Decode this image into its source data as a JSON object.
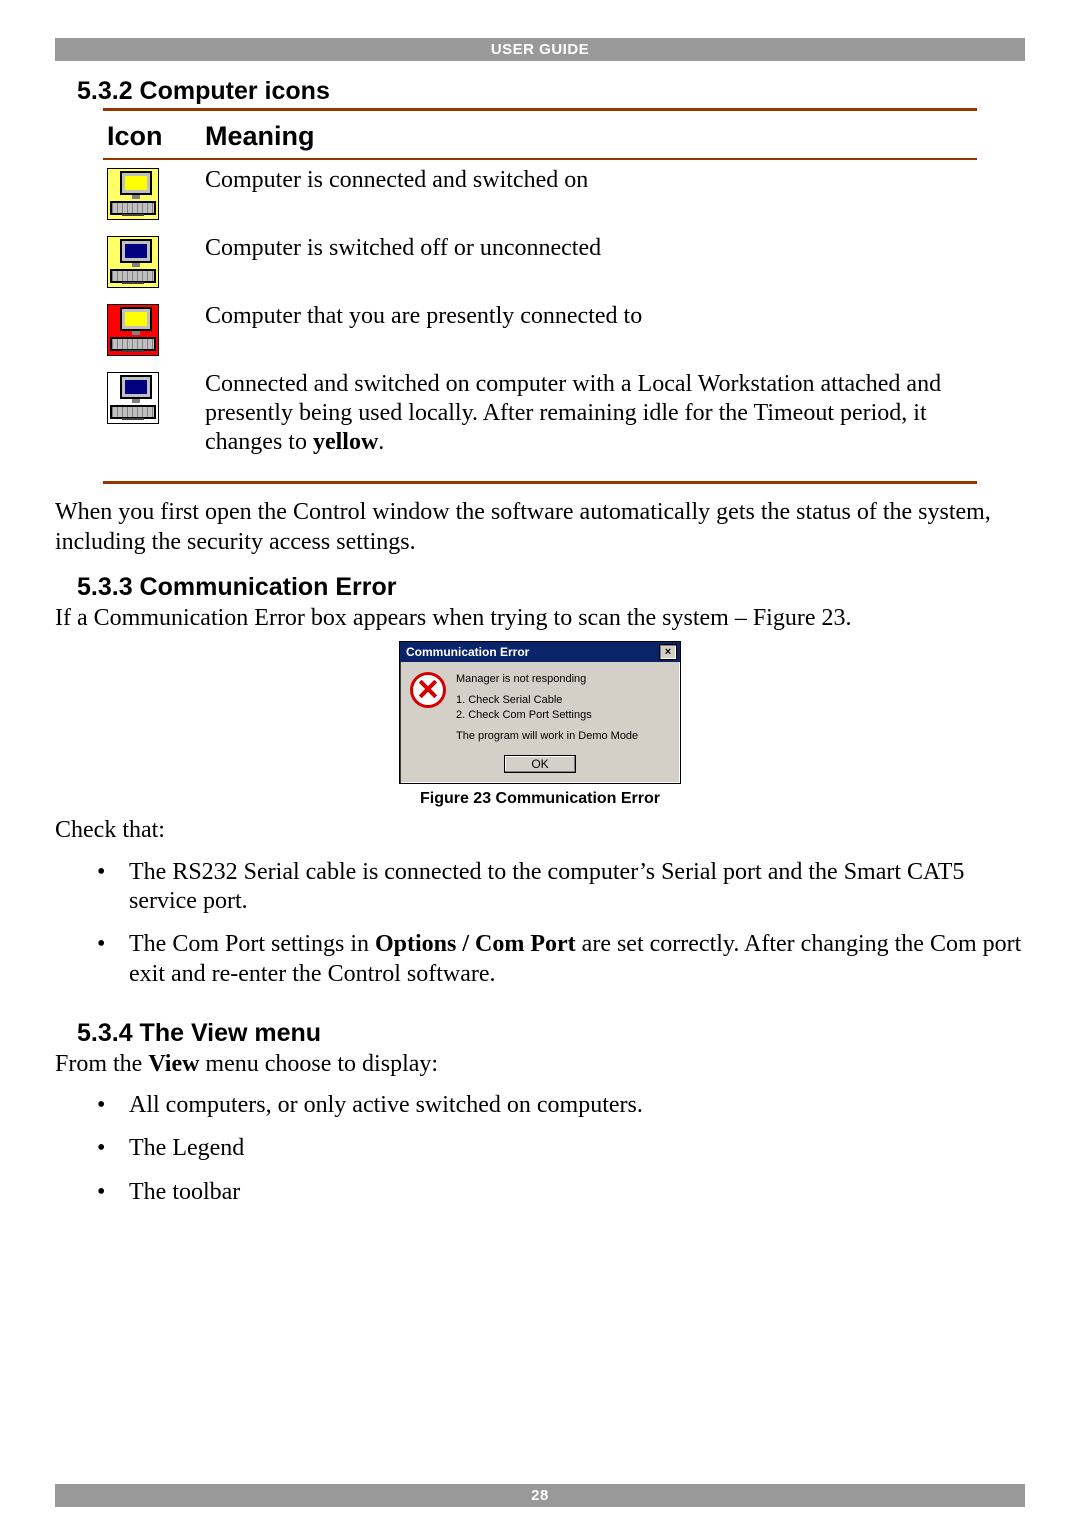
{
  "header": {
    "title": "USER GUIDE"
  },
  "footer": {
    "page_number": "28"
  },
  "section_icons": {
    "heading": "5.3.2 Computer icons",
    "col_icon": "Icon",
    "col_meaning": "Meaning",
    "rows": [
      {
        "icon": "computer-on-icon",
        "meaning_html": "Computer is connected and switched on"
      },
      {
        "icon": "computer-off-icon",
        "meaning_html": "Computer is switched off or unconnected"
      },
      {
        "icon": "computer-current-icon",
        "meaning_html": "Computer that you are presently connected to"
      },
      {
        "icon": "computer-local-icon",
        "meaning_html": "Connected and switched on computer with a Local Workstation attached and presently being used locally. After remaining idle for the Timeout period, it changes to <strong>yellow</strong>."
      }
    ],
    "after_table_text": "When you first open the Control window the software automatically gets the status of the system, including the security access settings."
  },
  "section_comm": {
    "heading": "5.3.3 Communication Error",
    "intro": "If a Communication Error box appears when trying to scan the system – Figure 23.",
    "dialog": {
      "title": "Communication Error",
      "close_glyph": "×",
      "line_main": "Manager is not responding",
      "check1": "1. Check Serial Cable",
      "check2": "2. Check Com Port Settings",
      "demo": "The program will work in Demo Mode",
      "ok": "OK"
    },
    "caption": "Figure 23 Communication Error",
    "check_that": "Check that:",
    "bullets": [
      "The RS232 Serial cable is connected to the computer’s Serial port and the Smart CAT5 service port.",
      "The Com Port settings in <strong>Options / Com Port</strong> are set correctly. After changing the Com port exit and re-enter the Control software."
    ]
  },
  "section_view": {
    "heading": "5.3.4 The View menu",
    "intro_html": "From the <strong>View</strong> menu choose to display:",
    "bullets": [
      "All computers, or only active switched on computers.",
      "The Legend",
      "The toolbar"
    ]
  },
  "colors": {
    "accent": "#993300"
  }
}
